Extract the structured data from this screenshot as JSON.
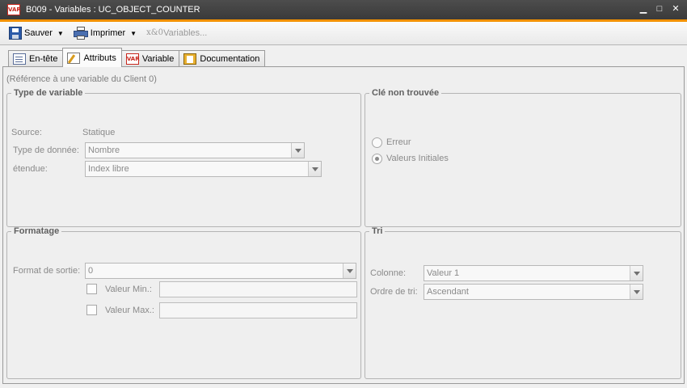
{
  "window": {
    "title": "B009 - Variables : UC_OBJECT_COUNTER",
    "app_icon_text": "VAR"
  },
  "toolbar": {
    "save_label": "Sauver",
    "print_label": "Imprimer",
    "variables_label": "Variables..."
  },
  "tabs": [
    {
      "label": "En-tête"
    },
    {
      "label": "Attributs"
    },
    {
      "label": "Variable"
    },
    {
      "label": "Documentation"
    }
  ],
  "reference_label": "(Référence à une variable du Client 0)",
  "type_variable": {
    "legend": "Type de variable",
    "source_label": "Source:",
    "source_value": "Statique",
    "data_type_label": "Type de donnée:",
    "data_type_value": "Nombre",
    "scope_label": "étendue:",
    "scope_value": "Index libre"
  },
  "key_not_found": {
    "legend": "Clé non trouvée",
    "option_error": "Erreur",
    "option_initial": "Valeurs Initiales",
    "selected": "Valeurs Initiales"
  },
  "formatting": {
    "legend": "Formatage",
    "output_format_label": "Format de sortie:",
    "output_format_value": "0",
    "min_label": "Valeur Min.:",
    "max_label": "Valeur Max.:"
  },
  "sort": {
    "legend": "Tri",
    "column_label": "Colonne:",
    "column_value": "Valeur 1",
    "order_label": "Ordre de tri:",
    "order_value": "Ascendant"
  }
}
